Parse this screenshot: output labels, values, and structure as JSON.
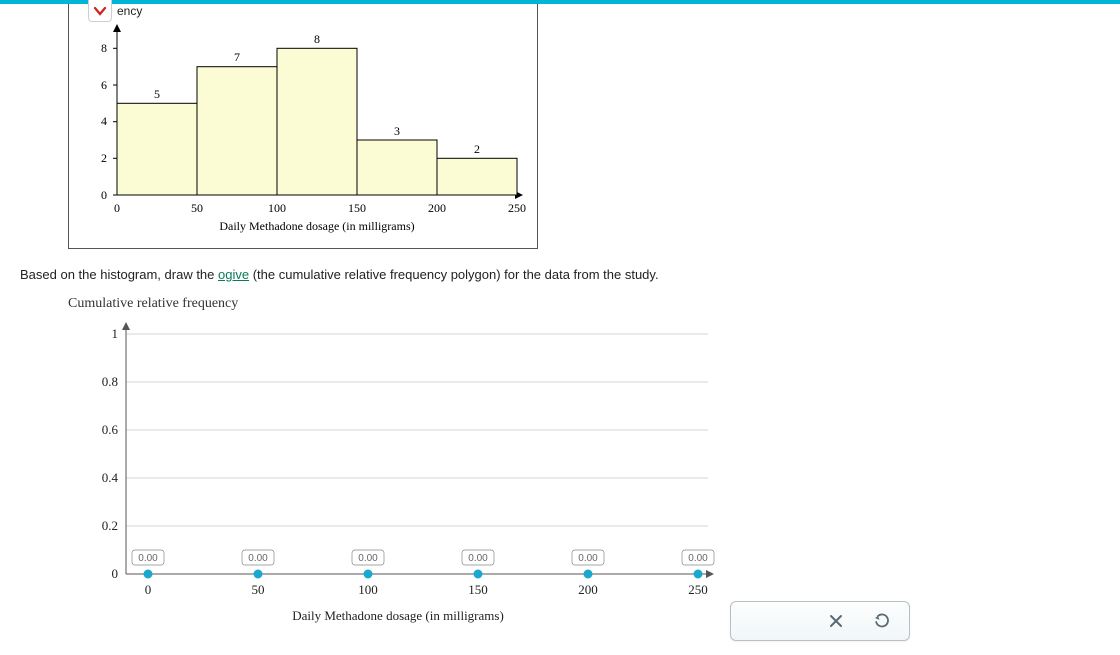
{
  "chart_data": [
    {
      "type": "bar",
      "title": "",
      "xlabel": "Daily Methadone dosage (in milligrams)",
      "ylabel": "Frequency",
      "categories": [
        "0–50",
        "50–100",
        "100–150",
        "150–200",
        "200–250"
      ],
      "values": [
        5,
        7,
        8,
        3,
        2
      ],
      "x_ticks": [
        0,
        50,
        100,
        150,
        200,
        250
      ],
      "y_ticks": [
        0,
        2,
        4,
        6,
        8
      ],
      "ylim": [
        0,
        9
      ]
    },
    {
      "type": "line",
      "title": "Cumulative relative frequency",
      "xlabel": "Daily Methadone dosage (in milligrams)",
      "ylabel": "",
      "x": [
        0,
        50,
        100,
        150,
        200,
        250
      ],
      "y": [
        0.0,
        0.0,
        0.0,
        0.0,
        0.0,
        0.0
      ],
      "x_ticks": [
        0,
        50,
        100,
        150,
        200,
        250
      ],
      "y_ticks": [
        0,
        0.2,
        0.4,
        0.6,
        0.8,
        1
      ],
      "ylim": [
        0,
        1
      ]
    }
  ],
  "histogram": {
    "ylabel_visible": "ency",
    "xlabel": "Daily Methadone dosage (in milligrams)",
    "bar_labels": [
      "5",
      "7",
      "8",
      "3",
      "2"
    ],
    "x_ticks": [
      "0",
      "50",
      "100",
      "150",
      "200",
      "250"
    ],
    "y_ticks": [
      "0",
      "2",
      "4",
      "6",
      "8"
    ]
  },
  "prompt": {
    "prefix": "Based on the histogram, draw the ",
    "link": "ogive",
    "suffix": " (the cumulative relative frequency polygon) for the data from the study."
  },
  "ogive": {
    "title": "Cumulative relative frequency",
    "xlabel": "Daily Methadone dosage (in milligrams)",
    "x_ticks": [
      "0",
      "50",
      "100",
      "150",
      "200",
      "250"
    ],
    "y_ticks": [
      "0",
      "0.2",
      "0.4",
      "0.6",
      "0.8",
      "1"
    ],
    "point_labels": [
      "0.00",
      "0.00",
      "0.00",
      "0.00",
      "0.00",
      "0.00"
    ]
  },
  "toolbox": {
    "close": "close",
    "reset": "reset"
  }
}
